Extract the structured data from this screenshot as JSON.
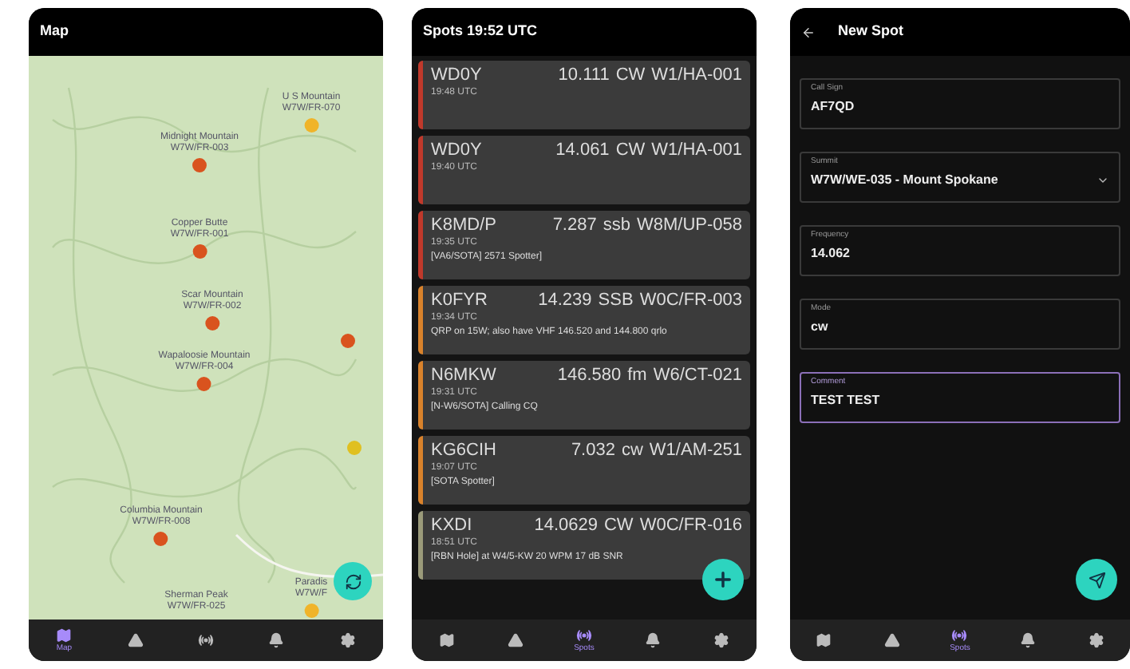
{
  "screens": [
    {
      "kind": "map",
      "title": "Map",
      "markers": [
        {
          "name": "U S Mountain",
          "ref": "W7W/FR-070",
          "color": "#f0b429"
        },
        {
          "name": "Midnight Mountain",
          "ref": "W7W/FR-003",
          "color": "#d9531e"
        },
        {
          "name": "Copper Butte",
          "ref": "W7W/FR-001",
          "color": "#d9531e"
        },
        {
          "name": "Scar Mountain",
          "ref": "W7W/FR-002",
          "color": "#d9531e"
        },
        {
          "name": "Wapaloosie Mountain",
          "ref": "W7W/FR-004",
          "color": "#d9531e"
        },
        {
          "color": "#d9531e"
        },
        {
          "color": "#e0c020"
        },
        {
          "name": "Columbia Mountain",
          "ref": "W7W/FR-008",
          "color": "#d9531e"
        },
        {
          "name": "Sherman Peak",
          "ref": "W7W/FR-025"
        },
        {
          "name": "Paradis",
          "ref": "W7W/F",
          "color": "#f0b429"
        }
      ],
      "nav": [
        {
          "label": "Map",
          "selected": true
        },
        {
          "selected": false
        },
        {
          "selected": false
        },
        {
          "selected": false
        },
        {
          "selected": false
        }
      ]
    },
    {
      "kind": "spots",
      "title": "Spots 19:52 UTC",
      "spots": [
        {
          "call": "WD0Y",
          "freq": "10.111",
          "mode": "CW",
          "ref": "W1/HA-001",
          "time": "19:48 UTC",
          "color": "#c0392b"
        },
        {
          "call": "WD0Y",
          "freq": "14.061",
          "mode": "CW",
          "ref": "W1/HA-001",
          "time": "19:40 UTC",
          "color": "#c0392b"
        },
        {
          "call": "K8MD/P",
          "freq": "7.287",
          "mode": "ssb",
          "ref": "W8M/UP-058",
          "time": "19:35 UTC",
          "comment": "[VA6/SOTA] 2571 Spotter]",
          "color": "#c0392b"
        },
        {
          "call": "K0FYR",
          "freq": "14.239",
          "mode": "SSB",
          "ref": "W0C/FR-003",
          "time": "19:34 UTC",
          "comment": "QRP on 15W; also have VHF 146.520 and 144.800 qrlo",
          "color": "#d9822b"
        },
        {
          "call": "N6MKW",
          "freq": "146.580",
          "mode": "fm",
          "ref": "W6/CT-021",
          "time": "19:31 UTC",
          "comment": "[N-W6/SOTA] Calling CQ",
          "color": "#d9822b"
        },
        {
          "call": "KG6CIH",
          "freq": "7.032",
          "mode": "cw",
          "ref": "W1/AM-251",
          "time": "19:07 UTC",
          "comment": "[SOTA Spotter]",
          "color": "#d9822b"
        },
        {
          "call": "KXDI",
          "freq": "14.0629",
          "mode": "CW",
          "ref": "W0C/FR-016",
          "time": "18:51 UTC",
          "comment": "[RBN Hole] at W4/5-KW 20 WPM 17 dB SNR",
          "color": "#9a9a7a"
        }
      ],
      "nav": [
        {
          "selected": false
        },
        {
          "selected": false
        },
        {
          "label": "Spots",
          "selected": true
        },
        {
          "selected": false
        },
        {
          "selected": false
        }
      ]
    },
    {
      "kind": "form",
      "title": "New Spot",
      "fields": [
        {
          "kind": "text",
          "label": "Call Sign",
          "value": "AF7QD",
          "focused": false
        },
        {
          "kind": "select",
          "label": "Summit",
          "value": "W7W/WE-035 - Mount Spokane",
          "focused": false
        },
        {
          "kind": "text",
          "label": "Frequency",
          "value": "14.062",
          "focused": false
        },
        {
          "kind": "text",
          "label": "Mode",
          "value": "cw",
          "focused": false
        },
        {
          "kind": "text",
          "label": "Comment",
          "value": "TEST TEST",
          "focused": true
        }
      ],
      "nav": [
        {
          "selected": false
        },
        {
          "selected": false
        },
        {
          "label": "Spots",
          "selected": true
        },
        {
          "selected": false
        },
        {
          "selected": false
        }
      ]
    }
  ]
}
